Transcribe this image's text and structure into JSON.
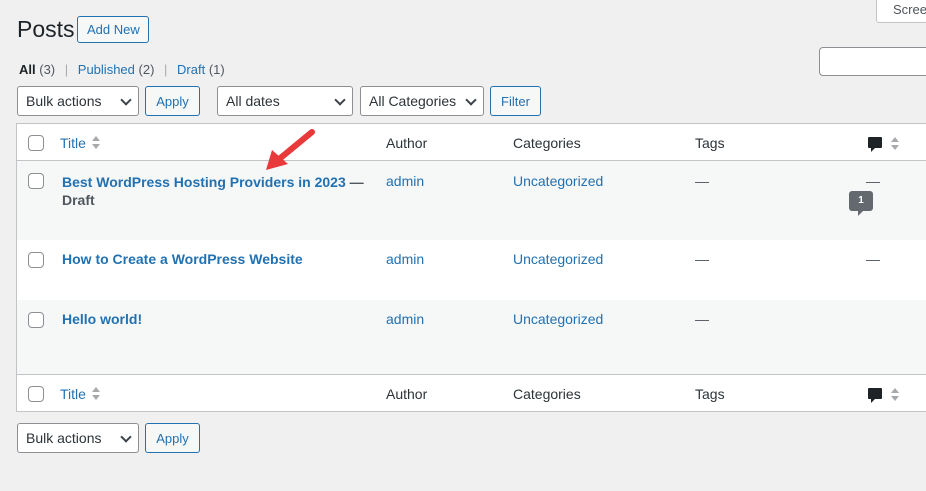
{
  "header": {
    "title": "Posts",
    "add_new_label": "Add New",
    "screen_options_label": "Screen Options"
  },
  "views": [
    {
      "label": "All",
      "count": "(3)"
    },
    {
      "label": "Published",
      "count": "(2)"
    },
    {
      "label": "Draft",
      "count": "(1)"
    }
  ],
  "search": {
    "value": ""
  },
  "filters": {
    "bulk_actions": "Bulk actions",
    "apply_label": "Apply",
    "dates": "All dates",
    "categories": "All Categories",
    "filter_label": "Filter"
  },
  "columns": {
    "title": "Title",
    "author": "Author",
    "categories": "Categories",
    "tags": "Tags"
  },
  "posts": [
    {
      "title": "Best WordPress Hosting Providers in 2023",
      "separator": " —",
      "state": "Draft",
      "author": "admin",
      "category": "Uncategorized",
      "tags": "—",
      "comments": "—"
    },
    {
      "title": "How to Create a WordPress Website",
      "author": "admin",
      "category": "Uncategorized",
      "tags": "—",
      "comments": "—"
    },
    {
      "title": "Hello world!",
      "author": "admin",
      "category": "Uncategorized",
      "tags": "—",
      "comments": "1"
    }
  ],
  "bottom": {
    "bulk_actions": "Bulk actions",
    "apply_label": "Apply"
  },
  "colors": {
    "link": "#2271b1",
    "background": "#f0f0f1",
    "annotation_arrow": "#e8393b"
  }
}
